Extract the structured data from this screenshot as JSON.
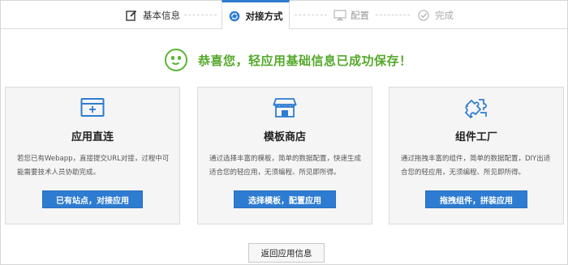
{
  "steps": [
    {
      "label": "基本信息",
      "icon": "edit-icon",
      "state": "done"
    },
    {
      "label": "对接方式",
      "icon": "sync-icon",
      "state": "active"
    },
    {
      "label": "配置",
      "icon": "monitor-icon",
      "state": "pending"
    },
    {
      "label": "完成",
      "icon": "check-circle-icon",
      "state": "pending"
    }
  ],
  "success": {
    "message": "恭喜您，轻应用基础信息已成功保存！",
    "icon": "smiley-icon",
    "color": "#55a92b"
  },
  "cards": [
    {
      "title": "应用直连",
      "icon": "browser-window-icon",
      "description": "若您已有Webapp，直接提交URL对接，过程中可能需要技术人员协助完成。",
      "button": "已有站点，对接应用"
    },
    {
      "title": "模板商店",
      "icon": "store-icon",
      "description": "通过选择丰富的模板，简单的数据配置，快速生成适合您的轻应用，无须编程、所见即所得。",
      "button": "选择模板，配置应用"
    },
    {
      "title": "组件工厂",
      "icon": "puzzle-icon",
      "description": "通过拖拽丰富的组件，简单的数据配置，DIY出适合您的轻应用，无须编程、所见即所得。",
      "button": "拖拽组件，拼装应用"
    }
  ],
  "back_button": "返回应用信息",
  "colors": {
    "accent": "#2e7cd1",
    "success": "#5cb531",
    "card_bg": "#f5f5f5"
  }
}
